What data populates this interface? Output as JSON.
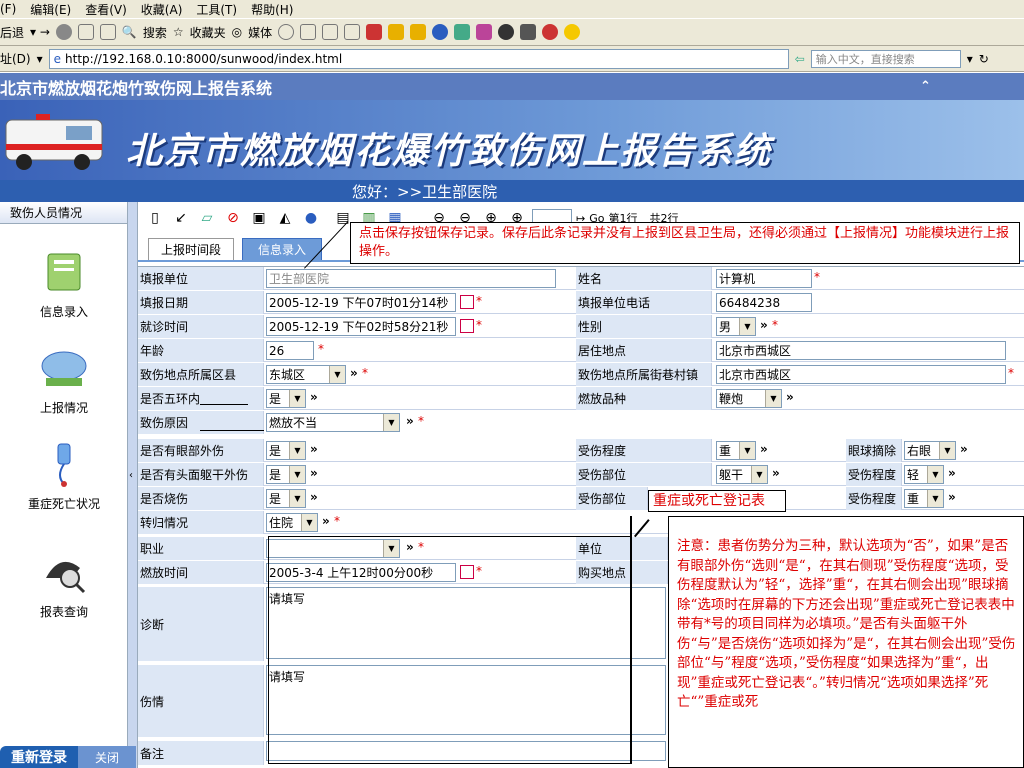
{
  "browser": {
    "menu": [
      "(F)",
      "编辑(E)",
      "查看(V)",
      "收藏(A)",
      "工具(T)",
      "帮助(H)"
    ],
    "toolbar": {
      "back": "后退",
      "search": "搜索",
      "favorites": "收藏夹",
      "media": "媒体"
    },
    "address_label": "址(D)",
    "url": "http://192.168.0.10:8000/sunwood/index.html",
    "search_placeholder": "输入中文，直接搜索"
  },
  "page": {
    "titlebar": "北京市燃放烟花炮竹致伤网上报告系统",
    "banner_title": "北京市燃放烟花爆竹致伤网上报告系统",
    "greeting": "您好：>>卫生部医院"
  },
  "sidebar": {
    "header": "致伤人员情况",
    "items": [
      {
        "label": "信息录入",
        "icon": "notebook-icon"
      },
      {
        "label": "上报情况",
        "icon": "satellite-dish-icon"
      },
      {
        "label": "重症死亡状况",
        "icon": "iv-drip-icon"
      },
      {
        "label": "报表查询",
        "icon": "magnifier-icon"
      }
    ],
    "relogin": "重新登录",
    "close": "关闭"
  },
  "toolbar": {
    "page_input": "",
    "go": "Go",
    "page_text": "第1行",
    "total_text": "共2行"
  },
  "tabs": [
    "上报时间段",
    "信息录入"
  ],
  "callout_top": "点击保存按钮保存记录。保存后此条记录并没有上报到区县卫生局，还得必须通过【上报情况】功能模块进行上报操作。",
  "callout_mid": "重症或死亡登记表",
  "form": {
    "unit_label": "填报单位",
    "unit_value": "卫生部医院",
    "name_label": "姓名",
    "name_value": "计算机",
    "date_label": "填报日期",
    "date_value": "2005-12-19 下午07时01分14秒",
    "phone_label": "填报单位电话",
    "phone_value": "66484238",
    "visit_label": "就诊时间",
    "visit_value": "2005-12-19 下午02时58分21秒",
    "sex_label": "性别",
    "sex_value": "男",
    "age_label": "年龄",
    "age_value": "26",
    "residence_label": "居住地点",
    "residence_value": "北京市西城区",
    "district_label": "致伤地点所属区县",
    "district_value": "东城区",
    "street_label": "致伤地点所属街巷村镇",
    "street_value": "北京市西城区",
    "ring_label": "是否五环内",
    "ring_value": "是",
    "variety_label": "燃放品种",
    "variety_value": "鞭炮",
    "cause_label": "致伤原因",
    "cause_value": "燃放不当",
    "eye_label": "是否有眼部外伤",
    "eye_value": "是",
    "severity_label": "受伤程度",
    "severity_value": "重",
    "eyeball_label": "眼球摘除",
    "eyeball_value": "右眼",
    "head_label": "是否有头面躯干外伤",
    "head_value": "是",
    "part_label": "受伤部位",
    "part_value": "躯干",
    "severity2_label": "受伤程度",
    "severity2_value": "轻",
    "burn_label": "是否烧伤",
    "burn_value": "是",
    "part2_label": "受伤部位",
    "severity3_label": "受伤程度",
    "severity3_value": "重",
    "transfer_label": "转归情况",
    "transfer_value": "住院",
    "job_label": "职业",
    "job_value": "",
    "workunit_label": "单位",
    "firetime_label": "燃放时间",
    "firetime_value": "2005-3-4 上午12时00分00秒",
    "buyplace_label": "购买地点",
    "diagnosis_label": "诊断",
    "diagnosis_value": "请填写",
    "injury_label": "伤情",
    "injury_value": "请填写",
    "remark_label": "备注",
    "star": "*",
    "more": "»"
  },
  "note": "注意：患者伤势分为三种，默认选项为“否”，如果”是否有眼部外伤“选则“是“，在其右侧现”受伤程度“选项，受伤程度默认为”轻“，选择”重“，在其右侧会出现”眼球摘除“选项时在屏幕的下方还会出现”重症或死亡登记表表中带有*号的项目同样为必填项。”是否有头面躯干外伤“与”是否烧伤“选项如择为”是“，在其右侧会出现”受伤部位“与”程度“选项，”受伤程度“如果选择为”重“，出现”重症或死亡登记表“。”转归情况“选项如果选择”死亡“”重症或死"
}
